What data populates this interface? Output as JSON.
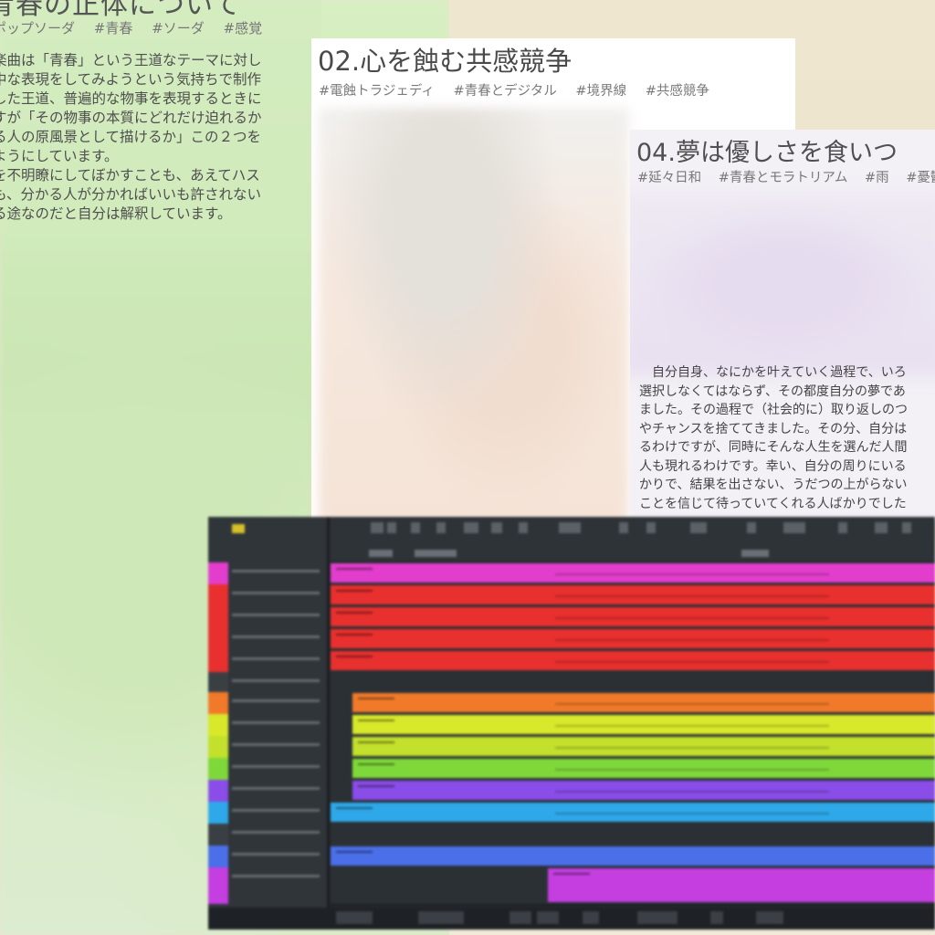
{
  "panel1": {
    "title": "青春の正体について",
    "tags": [
      "ポップソーダ",
      "#青春",
      "#ソーダ",
      "#感覚"
    ],
    "body": [
      "楽曲は「青春」という王道なテーマに対し",
      "中な表現をしてみようという気持ちで制作",
      "した王道、普遍的な物事を表現するときに",
      "すが「その物事の本質にどれだけ迫れるか",
      "る人の原風景として描けるか」この２つを",
      "ようにしています。",
      "を不明瞭にしてぼかすことも、あえてハス",
      "も、分かる人が分かればいいも許されない",
      "る途なのだと自分は解釈しています。"
    ]
  },
  "panel2": {
    "title": "02.心を蝕む共感競争",
    "tags": [
      "#電蝕トラジェディ",
      "#青春とデジタル",
      "#境界線",
      "#共感競争"
    ]
  },
  "panel4": {
    "title": "04.夢は優しさを食いつ",
    "tags": [
      "#延々日和",
      "#青春とモラトリアム",
      "#雨",
      "#憂鬱"
    ],
    "body": [
      "　自分自身、なにかを叶えていく過程で、いろ",
      "選択しなくてはならず、その都度自分の夢であ",
      "ました。その過程で（社会的に）取り返しのつ",
      "やチャンスを捨ててきました。その分、自分は",
      "るわけですが、同時にそんな人生を選んだ人間",
      "人も現れるわけです。幸い、自分の周りにいる",
      "かりで、結果を出さない、うだつの上がらない",
      "ことを信じて待っていてくれる人ばかりでした"
    ]
  },
  "daw": {
    "colors": {
      "background": "#262a2e",
      "magenta": "#e23dcc",
      "red": "#e8302e",
      "orange": "#f07a2a",
      "yellow": "#d8e82a",
      "lime": "#a8e02c",
      "green": "#7fd83a",
      "violet": "#8a4de8",
      "sky": "#2ea8e8",
      "blue": "#4a6fe8",
      "purple": "#c43ee0",
      "gray": "#3a3f44"
    },
    "tracks": [
      {
        "name": "track-1",
        "color": "#e23dcc"
      },
      {
        "name": "track-2",
        "color": "#e8302e"
      },
      {
        "name": "track-3",
        "color": "#e8302e"
      },
      {
        "name": "track-4",
        "color": "#e8302e"
      },
      {
        "name": "track-5",
        "color": "#e8302e"
      },
      {
        "name": "track-6",
        "color": "#3a3f44"
      },
      {
        "name": "track-7",
        "color": "#f07a2a"
      },
      {
        "name": "track-8",
        "color": "#d8e82a"
      },
      {
        "name": "track-9",
        "color": "#c2e02c"
      },
      {
        "name": "track-10",
        "color": "#7fd83a"
      },
      {
        "name": "track-11",
        "color": "#8a4de8"
      },
      {
        "name": "track-12",
        "color": "#2ea8e8"
      },
      {
        "name": "track-13",
        "color": "#3a3f44"
      },
      {
        "name": "track-14",
        "color": "#4a6fe8"
      },
      {
        "name": "track-15",
        "color": "#c43ee0"
      }
    ]
  }
}
